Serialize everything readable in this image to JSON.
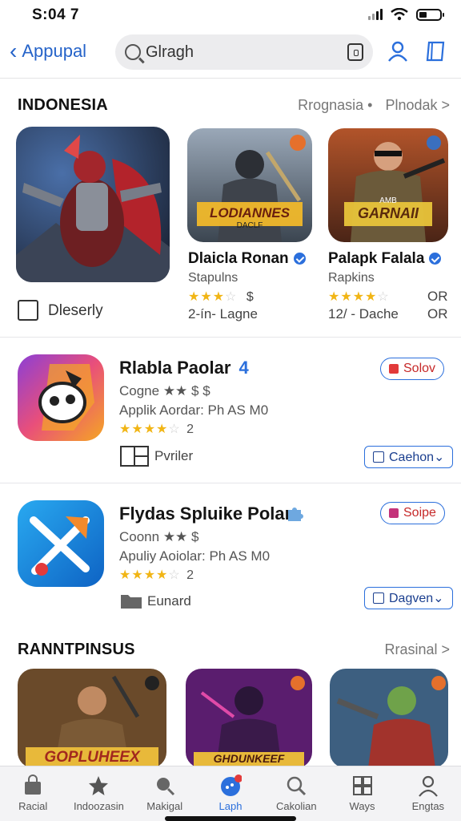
{
  "status": {
    "time": "S:04 7"
  },
  "nav": {
    "back_label": "Appupal",
    "search_value": "Glragh",
    "search_placeholder": "Glragh"
  },
  "section1": {
    "title": "INDONESIA",
    "link1": "Rrognasia •",
    "link2": "Plnodak >"
  },
  "featured": {
    "checkbox_label": "Dleserly",
    "cards": [
      {
        "title": "Dlaicla Ronan",
        "sub": "Stapulns",
        "stars_filled": "★★★",
        "stars_empty": "☆",
        "price": "$",
        "meta": "2-ín- Lagne",
        "art_text": "LODIANNES",
        "art_sub": "DACLF"
      },
      {
        "title": "Palapk Falala",
        "sub": "Rapkins",
        "stars_filled": "★★★★",
        "stars_empty": "☆",
        "price": "OR",
        "meta": "12/ - Dache",
        "meta_right": "OR",
        "art_text": "GARNAII",
        "art_sub": "AMB"
      }
    ]
  },
  "list": [
    {
      "name": "Rlabla Paolar",
      "badge": "4",
      "line1": "Cogne ★★ $ $",
      "line2": "Applik Aordar: Ph AS M0",
      "stars_filled": "★★★★",
      "stars_empty": "☆",
      "rating": "2",
      "footer": "Pvriler",
      "pill1": "Solov",
      "pill2": "Caehon⌄"
    },
    {
      "name": "Flydas Spluike Polar",
      "badge": "",
      "line1": "Coonn ★★ $",
      "line2": "Apuliy Aoiolar: Ph AS M0",
      "stars_filled": "★★★★",
      "stars_empty": "☆",
      "rating": "2",
      "footer": "Eunard",
      "pill1": "Soipe",
      "pill2": "Dagven⌄"
    }
  ],
  "section2": {
    "title": "RANNTPINSUS",
    "link": "Rrasinal >"
  },
  "bottom_art": [
    "GOPLUHEEX",
    "GHDUNKEEF",
    ""
  ],
  "tabs": [
    {
      "label": "Racial",
      "icon": "bag-icon"
    },
    {
      "label": "Indoozasin",
      "icon": "star-icon"
    },
    {
      "label": "Makigal",
      "icon": "search-person-icon"
    },
    {
      "label": "Laph",
      "icon": "apps-badge-icon",
      "active": true
    },
    {
      "label": "Cakolian",
      "icon": "search-icon"
    },
    {
      "label": "Ways",
      "icon": "grid-icon"
    },
    {
      "label": "Engtas",
      "icon": "person-icon"
    }
  ],
  "colors": {
    "accent": "#2b6fdc",
    "star": "#f1b515",
    "pill_red": "#c62828"
  }
}
